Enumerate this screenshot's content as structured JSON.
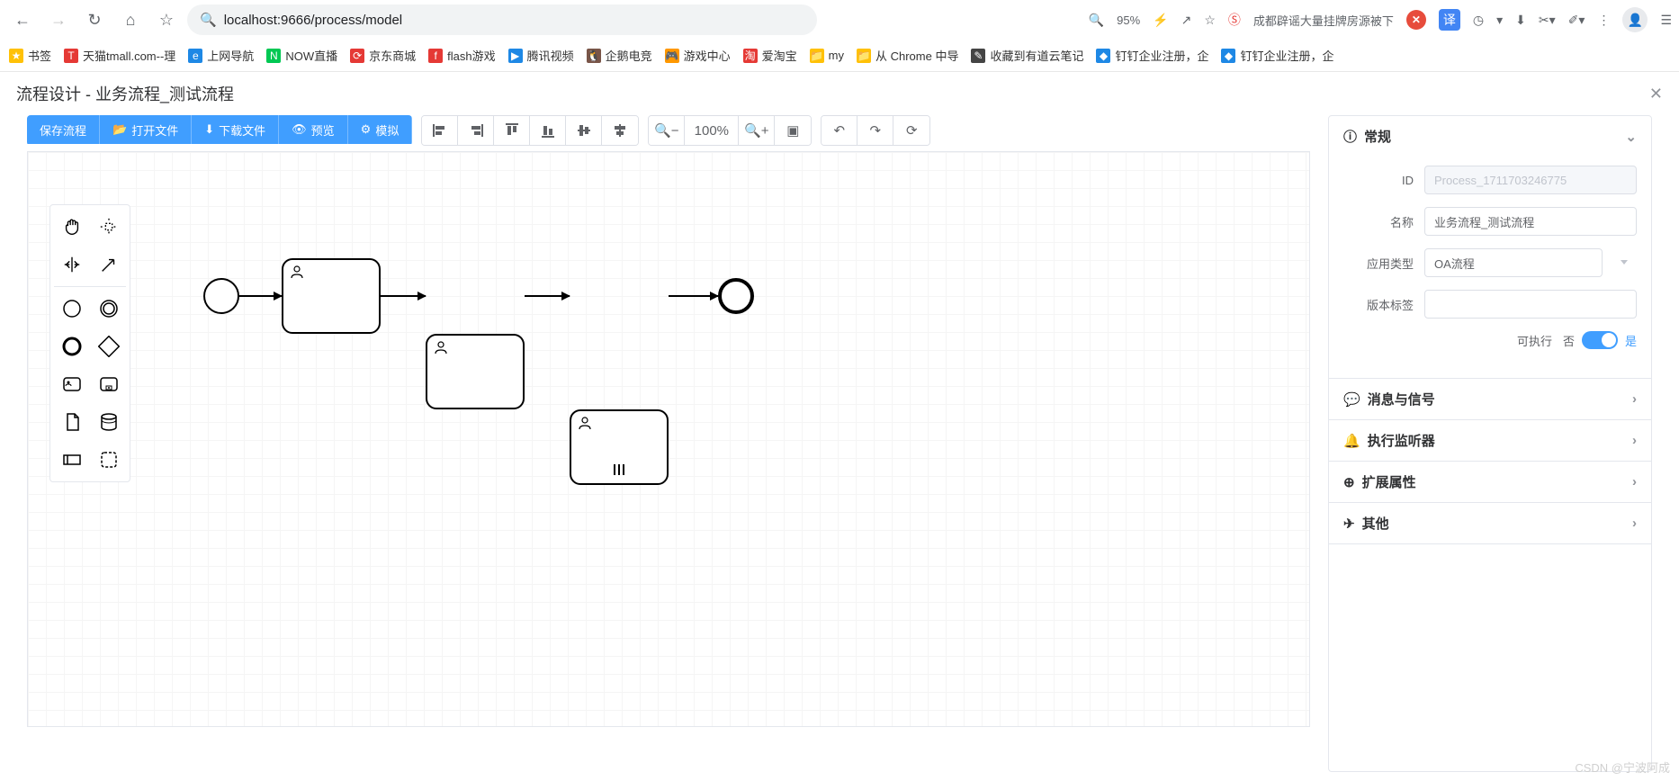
{
  "browser": {
    "url": "localhost:9666/process/model",
    "zoom": "95%",
    "tab_title": "成都辟谣大量挂牌房源被下"
  },
  "bookmarks": [
    {
      "label": "书签",
      "color": "#ffc107",
      "glyph": "★"
    },
    {
      "label": "天猫tmall.com--理",
      "color": "#e53935",
      "glyph": "T"
    },
    {
      "label": "上网导航",
      "color": "#1e88e5",
      "glyph": "e"
    },
    {
      "label": "NOW直播",
      "color": "#00c853",
      "glyph": "N"
    },
    {
      "label": "京东商城",
      "color": "#e53935",
      "glyph": "⟳"
    },
    {
      "label": "flash游戏",
      "color": "#e53935",
      "glyph": "f"
    },
    {
      "label": "腾讯视频",
      "color": "#1e88e5",
      "glyph": "▶"
    },
    {
      "label": "企鹅电竞",
      "color": "#795548",
      "glyph": "🐧"
    },
    {
      "label": "游戏中心",
      "color": "#ff9800",
      "glyph": "🎮"
    },
    {
      "label": "爱淘宝",
      "color": "#e53935",
      "glyph": "淘"
    },
    {
      "label": "my",
      "color": "#ffc107",
      "glyph": "📁"
    },
    {
      "label": "从 Chrome 中导",
      "color": "#ffc107",
      "glyph": "📁"
    },
    {
      "label": "收藏到有道云笔记",
      "color": "#444",
      "glyph": "✎"
    },
    {
      "label": "钉钉企业注册，企",
      "color": "#1e88e5",
      "glyph": "◆"
    },
    {
      "label": "钉钉企业注册，企",
      "color": "#1e88e5",
      "glyph": "◆"
    }
  ],
  "page_title": "流程设计 - 业务流程_测试流程",
  "toolbar": {
    "primary": [
      {
        "label": "保存流程",
        "icon": ""
      },
      {
        "label": "打开文件",
        "icon": "📂"
      },
      {
        "label": "下载文件",
        "icon": "⬇"
      },
      {
        "label": "预览",
        "icon": "👁"
      },
      {
        "label": "模拟",
        "icon": "⚙"
      }
    ],
    "zoom_value": "100%"
  },
  "panel": {
    "general": {
      "title": "常规",
      "id_label": "ID",
      "id_value": "Process_1711703246775",
      "name_label": "名称",
      "name_value": "业务流程_测试流程",
      "app_type_label": "应用类型",
      "app_type_value": "OA流程",
      "version_label": "版本标签",
      "version_value": "",
      "exec_label": "可执行",
      "exec_no": "否",
      "exec_yes": "是"
    },
    "sections": [
      {
        "title": "消息与信号",
        "icon": "💬"
      },
      {
        "title": "执行监听器",
        "icon": "🔔"
      },
      {
        "title": "扩展属性",
        "icon": "⊕"
      },
      {
        "title": "其他",
        "icon": "✈"
      }
    ]
  },
  "watermark": "CSDN @宁波阿成"
}
